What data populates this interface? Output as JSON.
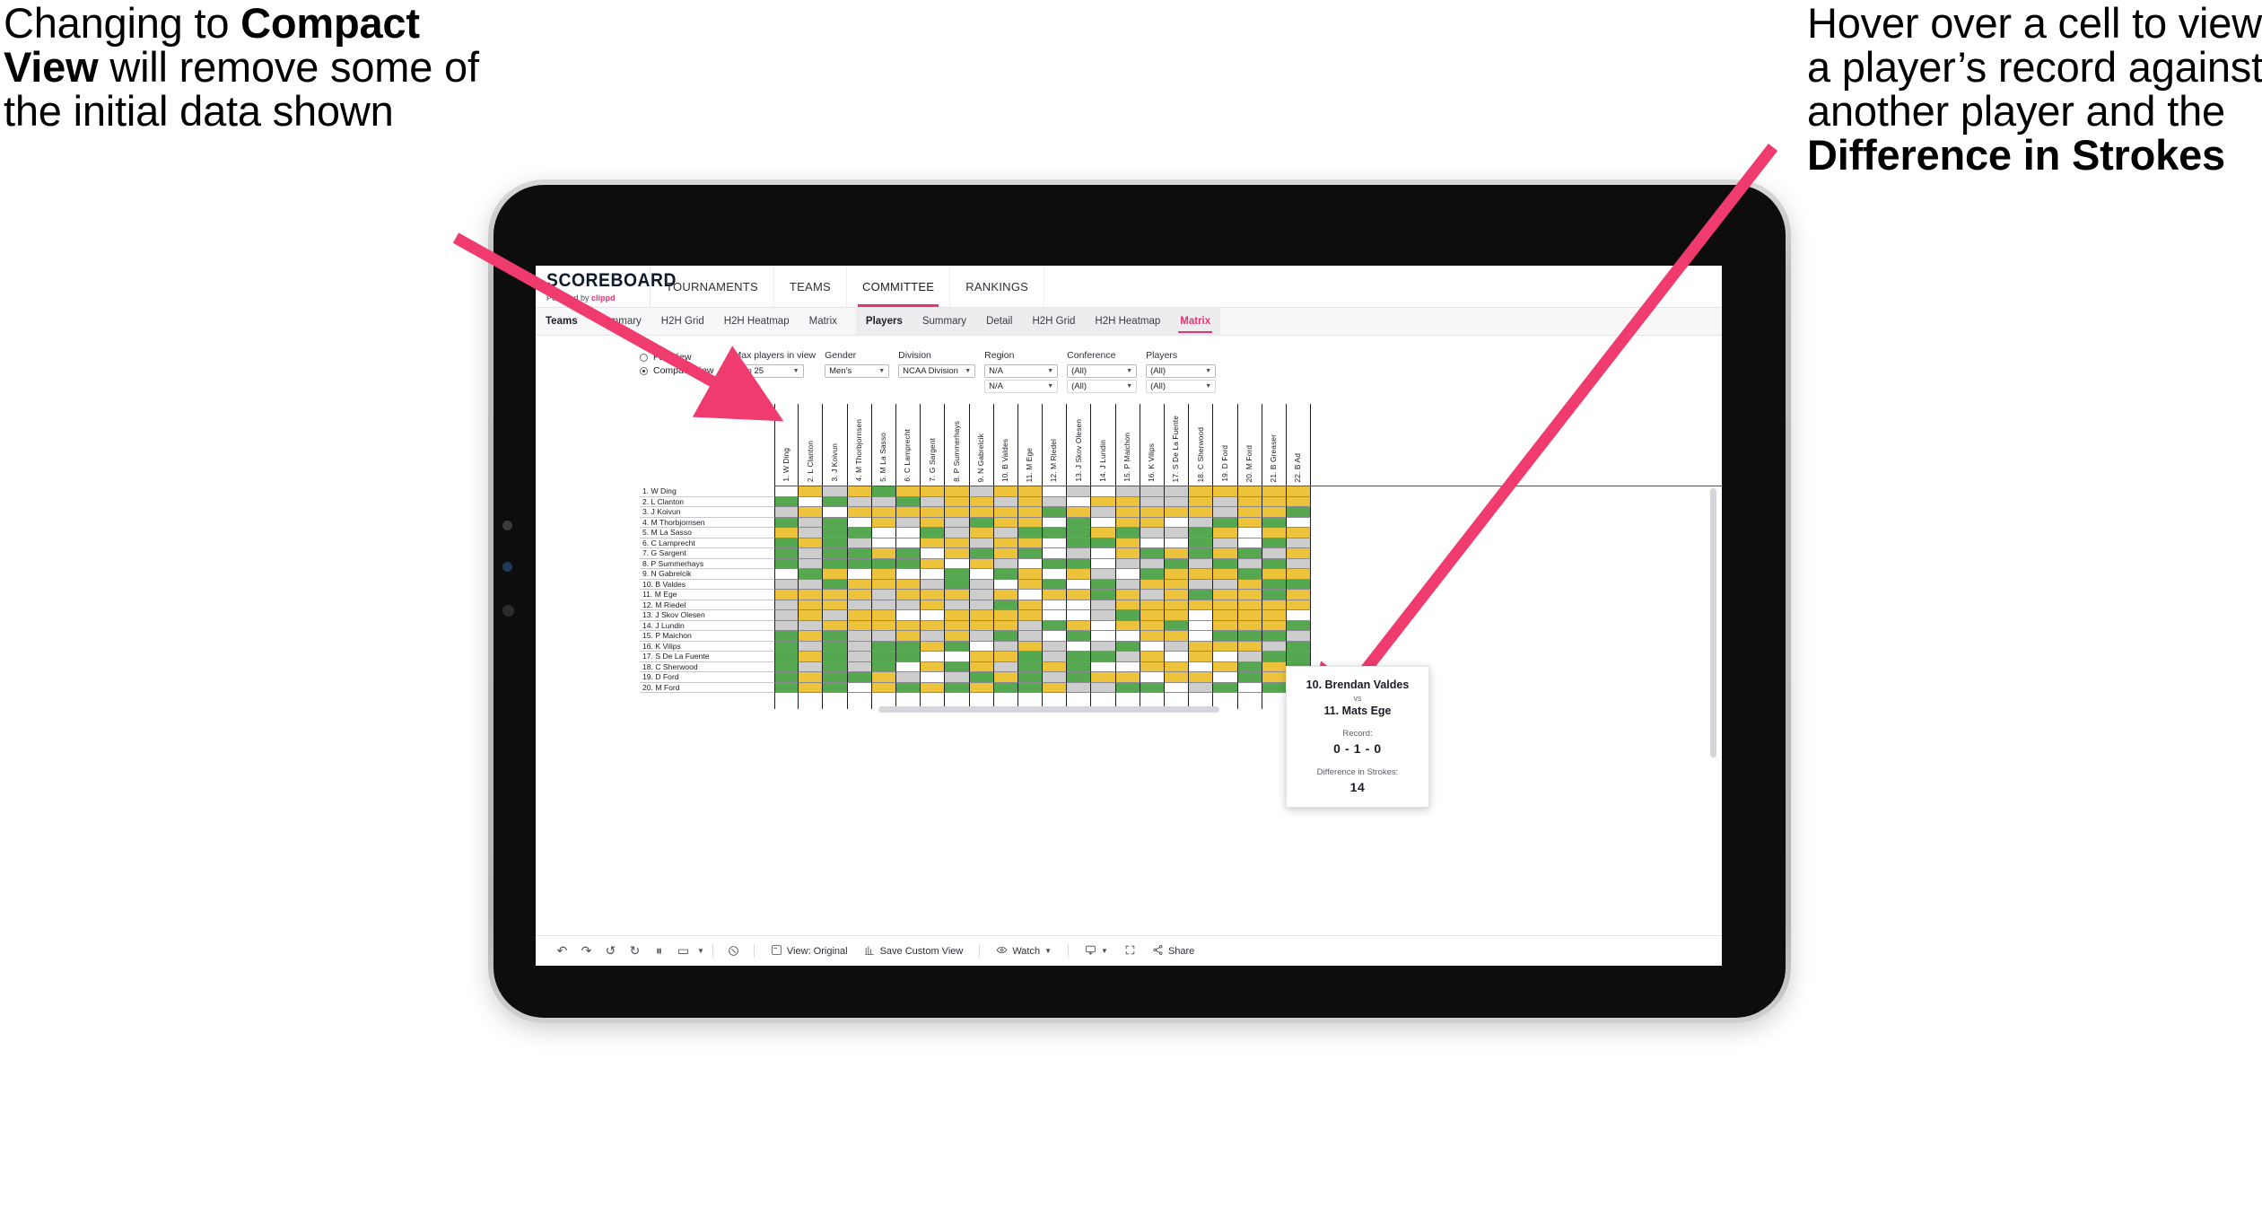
{
  "annotations": {
    "left": {
      "parts": [
        {
          "t": "Changing to ",
          "b": false
        },
        {
          "t": "Compact View",
          "b": true
        },
        {
          "t": " will remove some of the initial data shown",
          "b": false
        }
      ]
    },
    "right": {
      "parts": [
        {
          "t": "Hover over a cell to view a player’s record against another player and the ",
          "b": false
        },
        {
          "t": "Difference in Strokes",
          "b": true
        }
      ]
    },
    "arrow_color": "#ef3b6e"
  },
  "app": {
    "brand": {
      "name": "SCOREBOARD",
      "powered_prefix": "Powered by ",
      "powered_brand": "clippd"
    },
    "accent": "#e8336e",
    "topnav": [
      {
        "label": "TOURNAMENTS",
        "active": false
      },
      {
        "label": "TEAMS",
        "active": false
      },
      {
        "label": "COMMITTEE",
        "active": true
      },
      {
        "label": "RANKINGS",
        "active": false
      }
    ],
    "subnav_teams": [
      {
        "label": "Teams",
        "head": true,
        "active": false
      },
      {
        "label": "Summary",
        "head": false,
        "active": false
      },
      {
        "label": "H2H Grid",
        "head": false,
        "active": false
      },
      {
        "label": "H2H Heatmap",
        "head": false,
        "active": false
      },
      {
        "label": "Matrix",
        "head": false,
        "active": false
      }
    ],
    "subnav_players": [
      {
        "label": "Players",
        "head": true,
        "active": false
      },
      {
        "label": "Summary",
        "head": false,
        "active": false
      },
      {
        "label": "Detail",
        "head": false,
        "active": false
      },
      {
        "label": "H2H Grid",
        "head": false,
        "active": false
      },
      {
        "label": "H2H Heatmap",
        "head": false,
        "active": false
      },
      {
        "label": "Matrix",
        "head": false,
        "active": true
      }
    ]
  },
  "filters": {
    "view_mode": {
      "options": [
        {
          "label": "Full View",
          "selected": false
        },
        {
          "label": "Compact View",
          "selected": true
        }
      ]
    },
    "controls": [
      {
        "label": "Max players in view",
        "values": [
          "Top 25"
        ]
      },
      {
        "label": "Gender",
        "values": [
          "Men’s"
        ]
      },
      {
        "label": "Division",
        "values": [
          "NCAA Division I"
        ]
      },
      {
        "label": "Region",
        "values": [
          "N/A",
          "N/A"
        ]
      },
      {
        "label": "Conference",
        "values": [
          "(All)",
          "(All)"
        ]
      },
      {
        "label": "Players",
        "values": [
          "(All)",
          "(All)"
        ]
      }
    ]
  },
  "matrix": {
    "row_labels": [
      "1. W Ding",
      "2. L Clanton",
      "3. J Koivun",
      "4. M Thorbjornsen",
      "5. M La Sasso",
      "6. C Lamprecht",
      "7. G Sargent",
      "8. P Summerhays",
      "9. N Gabrelcik",
      "10. B Valdes",
      "11. M Ege",
      "12. M Riedel",
      "13. J Skov Olesen",
      "14. J Lundin",
      "15. P Maichon",
      "16. K Vilips",
      "17. S De La Fuente",
      "18. C Sherwood",
      "19. D Ford",
      "20. M Ford"
    ],
    "col_labels": [
      "1. W Ding",
      "2. L Clanton",
      "3. J Koivun",
      "4. M Thorbjornsen",
      "5. M La Sasso",
      "6. C Lamprecht",
      "7. G Sargent",
      "8. P Summerhays",
      "9. N Gabrelcik",
      "10. B Valdes",
      "11. M Ege",
      "12. M Riedel",
      "13. J Skov Olesen",
      "14. J Lundin",
      "15. P Maichon",
      "16. K Vilips",
      "17. S De La Fuente",
      "18. C Sherwood",
      "19. D Ford",
      "20. M Ford",
      "21. B Greaser",
      "22. B Ad"
    ],
    "legend_colors": {
      "win": "#55a84f",
      "loss": "#eec33c",
      "tie": "#cdcdcd",
      "none": "#ffffff"
    },
    "cells": [
      [
        "w",
        "y",
        "s",
        "y",
        "g",
        "y",
        "y",
        "y",
        "s",
        "y",
        "y",
        "w",
        "s",
        "w",
        "s",
        "s",
        "s",
        "y",
        "y",
        "y",
        "y",
        "y"
      ],
      [
        "g",
        "w",
        "g",
        "s",
        "s",
        "g",
        "s",
        "y",
        "y",
        "s",
        "y",
        "s",
        "w",
        "y",
        "y",
        "s",
        "s",
        "y",
        "s",
        "y",
        "y",
        "y"
      ],
      [
        "s",
        "y",
        "w",
        "y",
        "y",
        "y",
        "y",
        "y",
        "y",
        "y",
        "y",
        "g",
        "y",
        "s",
        "y",
        "y",
        "y",
        "y",
        "s",
        "y",
        "y",
        "g"
      ],
      [
        "g",
        "s",
        "g",
        "w",
        "y",
        "s",
        "y",
        "s",
        "g",
        "y",
        "y",
        "w",
        "g",
        "w",
        "y",
        "y",
        "w",
        "s",
        "g",
        "y",
        "g",
        "w"
      ],
      [
        "y",
        "s",
        "g",
        "g",
        "w",
        "w",
        "g",
        "s",
        "y",
        "s",
        "g",
        "g",
        "g",
        "y",
        "g",
        "s",
        "s",
        "g",
        "y",
        "w",
        "y",
        "y"
      ],
      [
        "g",
        "y",
        "g",
        "s",
        "w",
        "w",
        "y",
        "y",
        "s",
        "y",
        "y",
        "w",
        "g",
        "g",
        "y",
        "w",
        "w",
        "g",
        "s",
        "w",
        "g",
        "s"
      ],
      [
        "g",
        "s",
        "g",
        "g",
        "y",
        "g",
        "w",
        "y",
        "g",
        "y",
        "g",
        "w",
        "s",
        "w",
        "y",
        "g",
        "y",
        "g",
        "y",
        "g",
        "s",
        "y"
      ],
      [
        "g",
        "s",
        "g",
        "g",
        "g",
        "g",
        "y",
        "w",
        "y",
        "s",
        "w",
        "g",
        "g",
        "w",
        "s",
        "s",
        "g",
        "s",
        "g",
        "s",
        "g",
        "s"
      ],
      [
        "w",
        "g",
        "y",
        "w",
        "y",
        "w",
        "w",
        "g",
        "w",
        "g",
        "y",
        "w",
        "y",
        "s",
        "w",
        "g",
        "y",
        "y",
        "y",
        "g",
        "y",
        "y"
      ],
      [
        "s",
        "s",
        "g",
        "y",
        "y",
        "y",
        "s",
        "g",
        "s",
        "w",
        "y",
        "g",
        "w",
        "g",
        "s",
        "y",
        "y",
        "s",
        "s",
        "y",
        "g",
        "g"
      ],
      [
        "y",
        "y",
        "y",
        "y",
        "s",
        "y",
        "y",
        "y",
        "s",
        "y",
        "w",
        "y",
        "y",
        "g",
        "y",
        "s",
        "y",
        "g",
        "y",
        "y",
        "g",
        "y"
      ],
      [
        "s",
        "y",
        "y",
        "s",
        "s",
        "s",
        "y",
        "s",
        "s",
        "g",
        "y",
        "w",
        "w",
        "s",
        "y",
        "y",
        "y",
        "y",
        "y",
        "y",
        "y",
        "y"
      ],
      [
        "s",
        "y",
        "s",
        "y",
        "y",
        "w",
        "w",
        "y",
        "y",
        "y",
        "y",
        "w",
        "w",
        "s",
        "g",
        "y",
        "y",
        "w",
        "y",
        "y",
        "y",
        "w"
      ],
      [
        "s",
        "s",
        "y",
        "y",
        "y",
        "y",
        "y",
        "y",
        "y",
        "y",
        "s",
        "g",
        "y",
        "w",
        "y",
        "y",
        "g",
        "w",
        "y",
        "y",
        "y",
        "g"
      ],
      [
        "g",
        "y",
        "g",
        "s",
        "s",
        "y",
        "s",
        "y",
        "s",
        "g",
        "s",
        "w",
        "g",
        "w",
        "w",
        "y",
        "y",
        "w",
        "g",
        "g",
        "g",
        "s"
      ],
      [
        "g",
        "s",
        "g",
        "s",
        "g",
        "g",
        "y",
        "g",
        "w",
        "s",
        "y",
        "s",
        "w",
        "s",
        "g",
        "w",
        "s",
        "y",
        "y",
        "y",
        "s",
        "g"
      ],
      [
        "g",
        "y",
        "g",
        "s",
        "g",
        "g",
        "w",
        "w",
        "y",
        "y",
        "g",
        "s",
        "g",
        "g",
        "s",
        "y",
        "w",
        "y",
        "w",
        "s",
        "g",
        "g"
      ],
      [
        "g",
        "s",
        "g",
        "s",
        "g",
        "w",
        "y",
        "g",
        "y",
        "s",
        "g",
        "y",
        "g",
        "w",
        "w",
        "y",
        "y",
        "w",
        "y",
        "g",
        "y",
        "g"
      ],
      [
        "g",
        "y",
        "g",
        "g",
        "y",
        "s",
        "w",
        "s",
        "g",
        "y",
        "g",
        "s",
        "g",
        "y",
        "y",
        "w",
        "y",
        "y",
        "w",
        "g",
        "y",
        "g"
      ],
      [
        "g",
        "y",
        "g",
        "w",
        "y",
        "g",
        "y",
        "g",
        "y",
        "g",
        "g",
        "y",
        "s",
        "s",
        "g",
        "g",
        "w",
        "s",
        "g",
        "w",
        "g",
        "g"
      ]
    ]
  },
  "tooltip": {
    "player_a": "10. Brendan Valdes",
    "vs": "vs",
    "player_b": "11. Mats Ege",
    "record_label": "Record:",
    "record_value": "0 - 1 - 0",
    "strokes_label": "Difference in Strokes:",
    "strokes_value": "14"
  },
  "toolbar": {
    "icons": [
      {
        "name": "undo-icon",
        "glyph": "↶"
      },
      {
        "name": "redo-icon",
        "glyph": "↷"
      },
      {
        "name": "revert-icon",
        "glyph": "↺"
      },
      {
        "name": "refresh-data-icon",
        "glyph": "↻"
      },
      {
        "name": "pause-updates-icon",
        "glyph": "⏸"
      },
      {
        "name": "highlight-icon",
        "glyph": "▭"
      }
    ],
    "buttons": [
      {
        "name": "view-original-button",
        "icon": "view-icon",
        "label": "View: Original"
      },
      {
        "name": "save-custom-view-button",
        "icon": "save-view-icon",
        "label": "Save Custom View"
      },
      {
        "name": "watch-button",
        "icon": "eye-icon",
        "label": "Watch",
        "caret": true
      },
      {
        "name": "download-button",
        "icon": "download-icon",
        "label": "",
        "caret": true
      },
      {
        "name": "fullscreen-button",
        "icon": "fullscreen-icon",
        "label": ""
      },
      {
        "name": "share-button",
        "icon": "share-icon",
        "label": "Share"
      }
    ],
    "help_icon": "help-icon"
  }
}
